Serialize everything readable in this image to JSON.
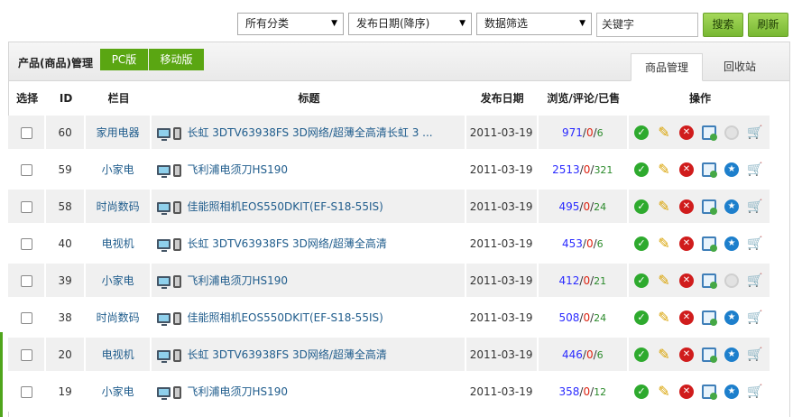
{
  "toolbar": {
    "category_select": "所有分类",
    "sort_select": "发布日期(降序)",
    "filter_select": "数据筛选",
    "keyword_value": "关键字",
    "search_label": "搜索",
    "refresh_label": "刷新"
  },
  "panel": {
    "title": "产品(商品)管理",
    "version_tabs": [
      "PC版",
      "移动版"
    ],
    "right_tabs": [
      "商品管理",
      "回收站"
    ]
  },
  "table": {
    "headers": [
      "选择",
      "ID",
      "栏目",
      "标题",
      "发布日期",
      "浏览/评论/已售",
      "操作"
    ],
    "rows": [
      {
        "id": "60",
        "category": "家用电器",
        "title": "长虹 3DTV63938FS 3D网络/超薄全高清长虹 3 ...",
        "date": "2011-03-19",
        "views": "971",
        "comments": "0",
        "sold": "6",
        "recommended": false
      },
      {
        "id": "59",
        "category": "小家电",
        "title": "飞利浦电须刀HS190",
        "date": "2011-03-19",
        "views": "2513",
        "comments": "0",
        "sold": "321",
        "recommended": true
      },
      {
        "id": "58",
        "category": "时尚数码",
        "title": "佳能照相机EOS550DKIT(EF-S18-55IS)",
        "date": "2011-03-19",
        "views": "495",
        "comments": "0",
        "sold": "24",
        "recommended": true
      },
      {
        "id": "40",
        "category": "电视机",
        "title": "长虹 3DTV63938FS 3D网络/超薄全高清",
        "date": "2011-03-19",
        "views": "453",
        "comments": "0",
        "sold": "6",
        "recommended": true
      },
      {
        "id": "39",
        "category": "小家电",
        "title": "飞利浦电须刀HS190",
        "date": "2011-03-19",
        "views": "412",
        "comments": "0",
        "sold": "21",
        "recommended": false
      },
      {
        "id": "38",
        "category": "时尚数码",
        "title": "佳能照相机EOS550DKIT(EF-S18-55IS)",
        "date": "2011-03-19",
        "views": "508",
        "comments": "0",
        "sold": "24",
        "recommended": true
      },
      {
        "id": "20",
        "category": "电视机",
        "title": "长虹 3DTV63938FS 3D网络/超薄全高清",
        "date": "2011-03-19",
        "views": "446",
        "comments": "0",
        "sold": "6",
        "recommended": true
      },
      {
        "id": "19",
        "category": "小家电",
        "title": "飞利浦电须刀HS190",
        "date": "2011-03-19",
        "views": "358",
        "comments": "0",
        "sold": "12",
        "recommended": true
      }
    ]
  },
  "colors": {
    "accent_green": "#5aa612",
    "link_blue": "#1f5c8c"
  }
}
